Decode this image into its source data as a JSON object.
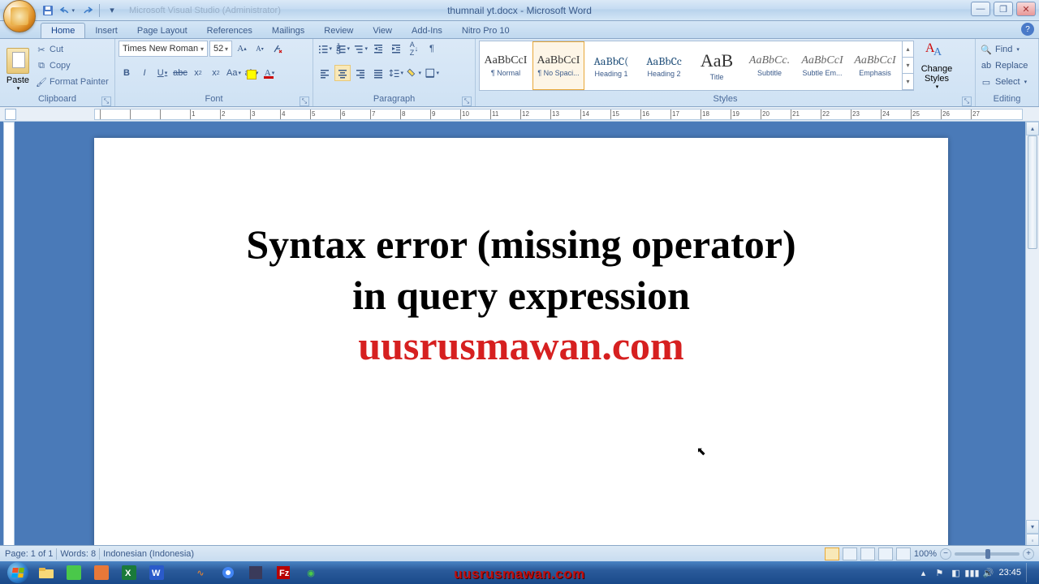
{
  "title": "thumnail yt.docx - Microsoft Word",
  "qat_faint": "Microsoft Visual Studio (Administrator)",
  "tabs": [
    "Home",
    "Insert",
    "Page Layout",
    "References",
    "Mailings",
    "Review",
    "View",
    "Add-Ins",
    "Nitro Pro 10"
  ],
  "active_tab": 0,
  "clipboard": {
    "paste": "Paste",
    "cut": "Cut",
    "copy": "Copy",
    "format_painter": "Format Painter",
    "label": "Clipboard"
  },
  "font": {
    "name": "Times New Roman",
    "size": "52",
    "label": "Font"
  },
  "paragraph": {
    "label": "Paragraph"
  },
  "styles": {
    "label": "Styles",
    "items": [
      {
        "name": "¶ Normal",
        "preview": "AaBbCcI"
      },
      {
        "name": "¶ No Spaci...",
        "preview": "AaBbCcI"
      },
      {
        "name": "Heading 1",
        "preview": "AaBbC("
      },
      {
        "name": "Heading 2",
        "preview": "AaBbCc"
      },
      {
        "name": "Title",
        "preview": "AaB"
      },
      {
        "name": "Subtitle",
        "preview": "AaBbCc."
      },
      {
        "name": "Subtle Em...",
        "preview": "AaBbCcI"
      },
      {
        "name": "Emphasis",
        "preview": "AaBbCcI"
      }
    ],
    "selected": 1,
    "change": "Change Styles"
  },
  "editing": {
    "find": "Find",
    "replace": "Replace",
    "select": "Select",
    "label": "Editing"
  },
  "document": {
    "line1": "Syntax error (missing operator)",
    "line2": "in query expression",
    "line3": "uusrusmawan.com"
  },
  "status": {
    "page": "Page: 1 of 1",
    "words": "Words: 8",
    "lang": "Indonesian (Indonesia)",
    "zoom": "100%"
  },
  "tray": {
    "time": "23:45"
  },
  "watermark": "uusrusmawan.com"
}
